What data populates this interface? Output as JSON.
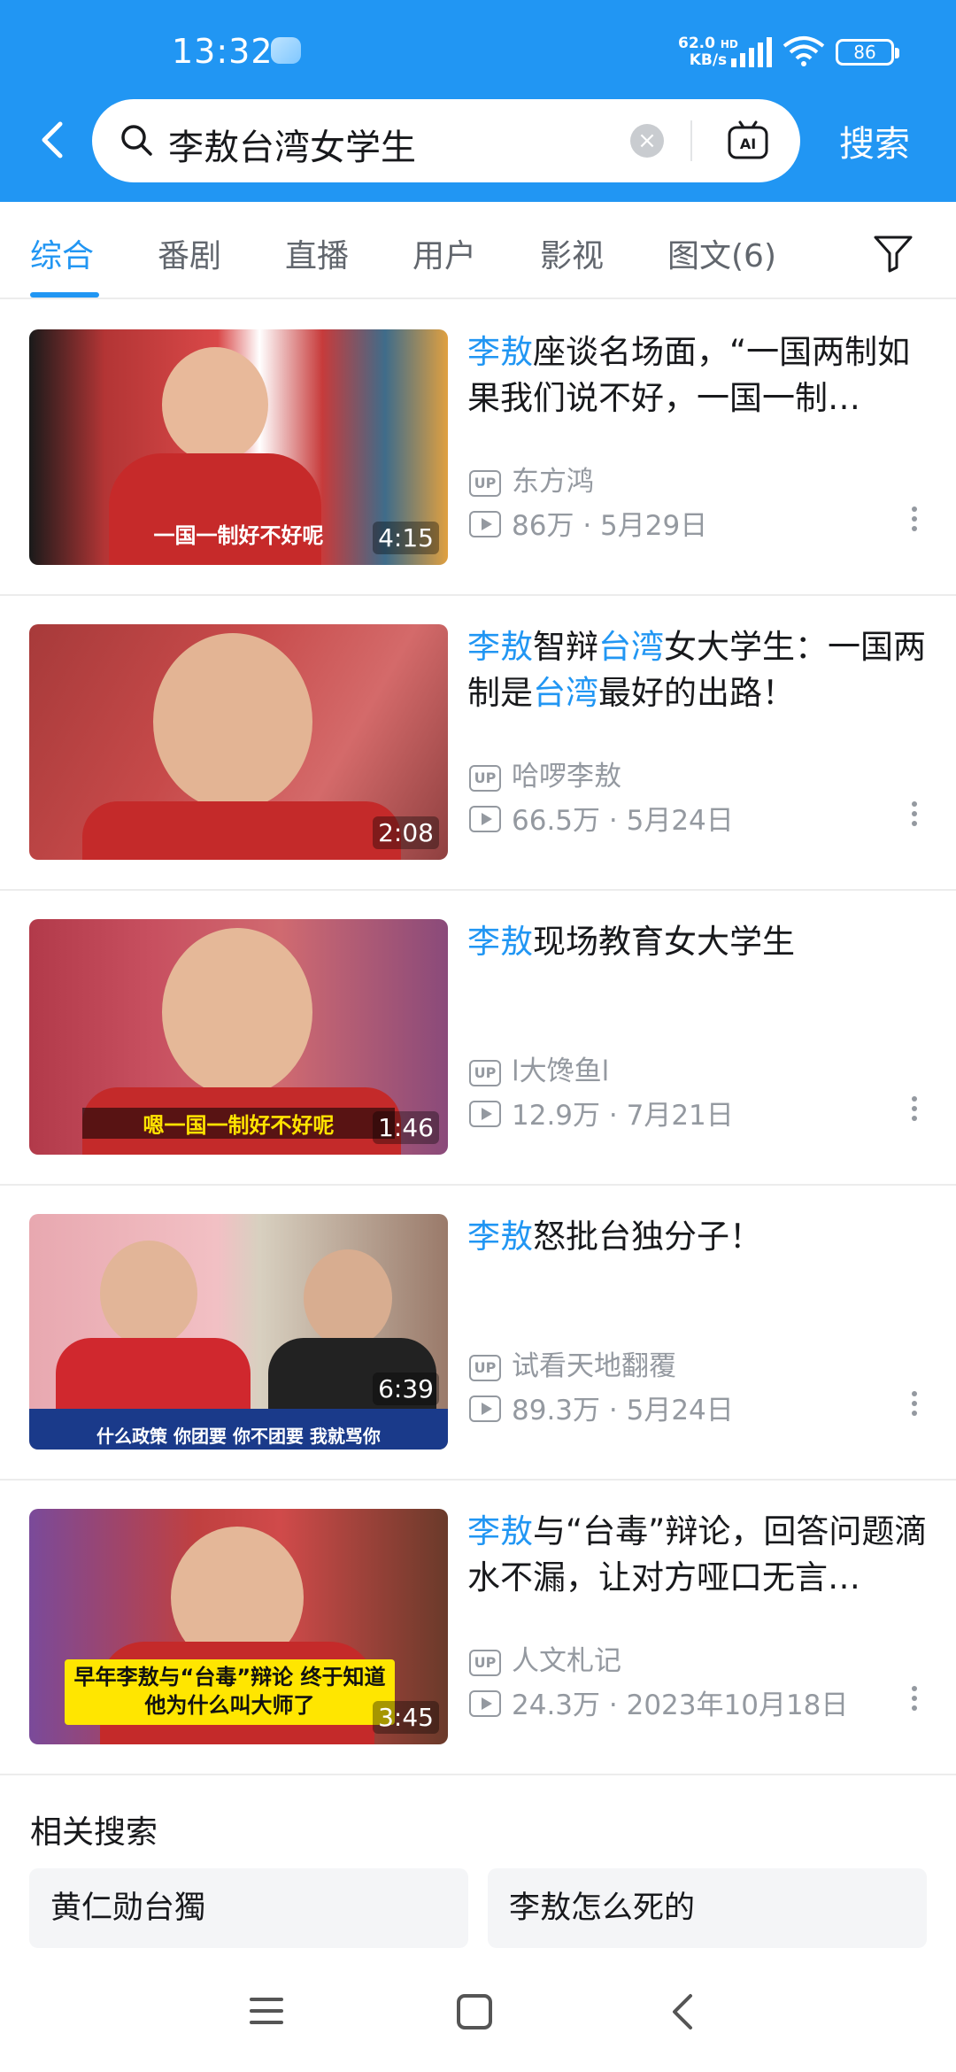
{
  "status_bar": {
    "time": "13:32",
    "net_speed_value": "62.0",
    "net_speed_unit": "KB/s",
    "network_tag": "HD",
    "battery": "86"
  },
  "search": {
    "query": "李敖台湾女学生",
    "button_label": "搜索",
    "clear_symbol": "×"
  },
  "tabs": [
    {
      "label": "综合",
      "active": true
    },
    {
      "label": "番剧"
    },
    {
      "label": "直播"
    },
    {
      "label": "用户"
    },
    {
      "label": "影视"
    },
    {
      "label": "图文(6)"
    }
  ],
  "videos": [
    {
      "title_parts": [
        [
          "李敖",
          "hl"
        ],
        [
          "座谈名场面，“一国两制如果我们说不好，一国一制…",
          ""
        ]
      ],
      "duration": "4:15",
      "thumb_caption": "一国一制好不好呢",
      "uploader": "东方鸿",
      "views": "86万",
      "date": "5月29日"
    },
    {
      "title_parts": [
        [
          "李敖",
          "hl"
        ],
        [
          "智辩",
          ""
        ],
        [
          "台湾",
          "hl"
        ],
        [
          "女大学生：一国两制是",
          ""
        ],
        [
          "台湾",
          "hl"
        ],
        [
          "最好的出路！",
          ""
        ]
      ],
      "duration": "2:08",
      "uploader": "哈啰李敖",
      "views": "66.5万",
      "date": "5月24日"
    },
    {
      "title_parts": [
        [
          "李敖",
          "hl"
        ],
        [
          "现场教育女大学生",
          ""
        ]
      ],
      "duration": "1:46",
      "thumb_caption": "嗯一国一制好不好呢",
      "uploader": "l大馋鱼l",
      "views": "12.9万",
      "date": "7月21日"
    },
    {
      "title_parts": [
        [
          "李敖",
          "hl"
        ],
        [
          "怒批台独分子！",
          ""
        ]
      ],
      "duration": "6:39",
      "thumb_caption": "什么政策 你团要 你不团要 我就骂你",
      "uploader": "试看天地翻覆",
      "views": "89.3万",
      "date": "5月24日"
    },
    {
      "title_parts": [
        [
          "李敖",
          "hl"
        ],
        [
          "与“台毒”辩论，回答问题滴水不漏，让对方哑口无言…",
          ""
        ]
      ],
      "duration": "3:45",
      "thumb_caption": "早年李敖与“台毒”辩论 终于知道他为什么叫大师了",
      "uploader": "人文札记",
      "views": "24.3万",
      "date": "2023年10月18日"
    }
  ],
  "up_badge": "UP",
  "meta_sep": "·",
  "related": {
    "title": "相关搜索",
    "items": [
      "黄仁勋台獨",
      "李敖怎么死的"
    ]
  },
  "colors": {
    "brand_blue": "#2196f3",
    "meta_gray": "#9499a0"
  }
}
